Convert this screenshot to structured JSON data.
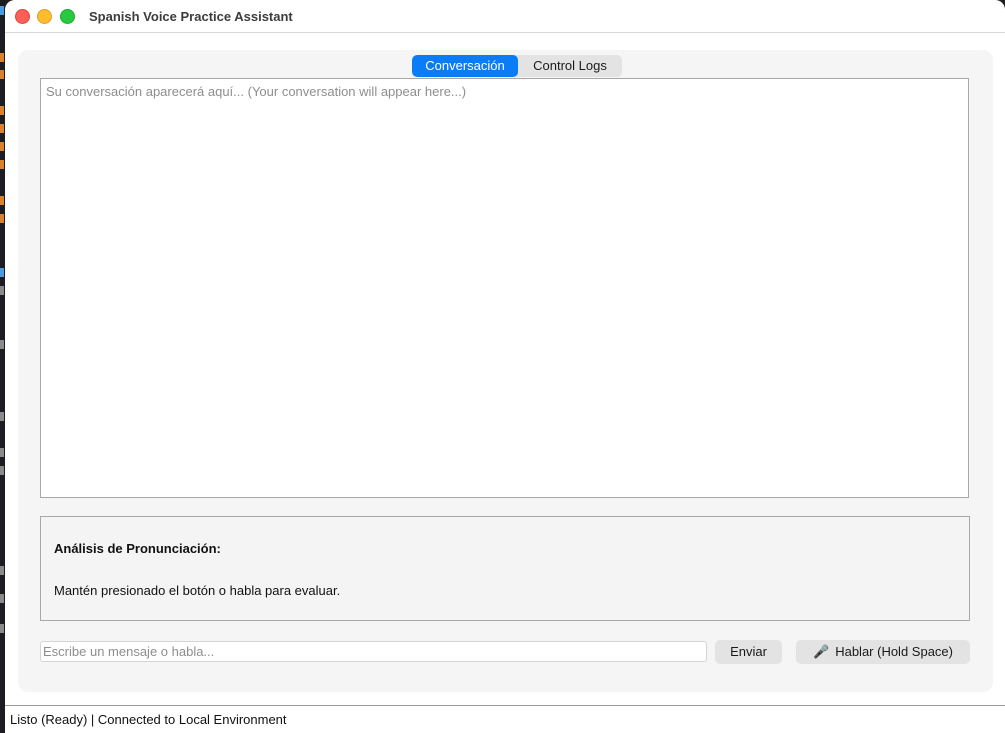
{
  "window": {
    "title": "Spanish Voice Practice Assistant"
  },
  "tabs": [
    {
      "label": "Conversación",
      "active": true
    },
    {
      "label": "Control  Logs",
      "active": false
    }
  ],
  "conversation": {
    "placeholder": "Su conversación aparecerá aquí... (Your conversation will appear here...)"
  },
  "analysis": {
    "heading": "Análisis de Pronunciación:",
    "body": "Mantén presionado el botón o habla para evaluar."
  },
  "composer": {
    "input_value": "",
    "input_placeholder": "Escribe un mensaje o habla...",
    "send_label": "Enviar",
    "speak_icon": "microphone-icon",
    "speak_label": "Hablar (Hold Space)"
  },
  "status": {
    "text": "Listo (Ready) | Connected to Local Environment"
  },
  "colors": {
    "accent": "#0a7cf6",
    "close": "#fe5f57",
    "minimize": "#febc2e",
    "maximize": "#28c840"
  }
}
